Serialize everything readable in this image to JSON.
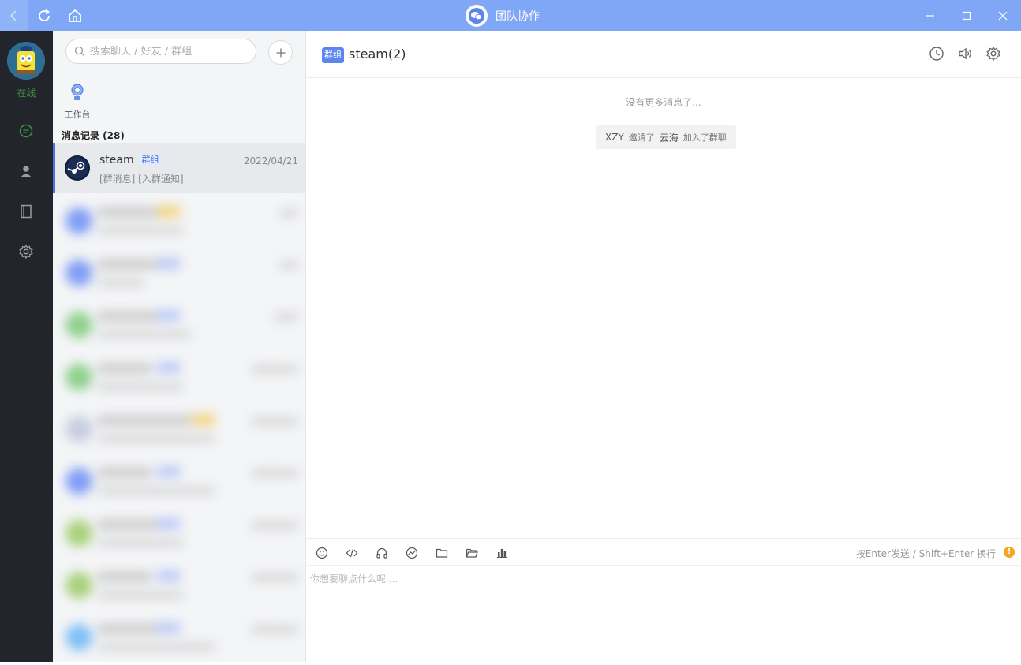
{
  "window": {
    "title": "团队协作"
  },
  "user": {
    "status": "在线"
  },
  "search": {
    "placeholder": "搜索聊天 / 好友 / 群组"
  },
  "workbench": {
    "label": "工作台"
  },
  "message_section": {
    "title": "消息记录 (28)"
  },
  "active_chat": {
    "name": "steam",
    "badge": "群组",
    "date": "2022/04/21",
    "preview": "[群消息] [入群通知]"
  },
  "header": {
    "badge": "群组",
    "title": "steam(2)"
  },
  "messages": {
    "no_more": "没有更多消息了...",
    "notice": {
      "inviter": "XZY",
      "action": "邀请了",
      "invitee": "云海",
      "result": "加入了群聊"
    }
  },
  "composer": {
    "hint": "按Enter发送 / Shift+Enter 换行",
    "placeholder": "你想要聊点什么呢 ..."
  },
  "colors": {
    "titlebar": "#7fa7f5",
    "rail": "#22252b",
    "accent": "#4a72e6"
  }
}
